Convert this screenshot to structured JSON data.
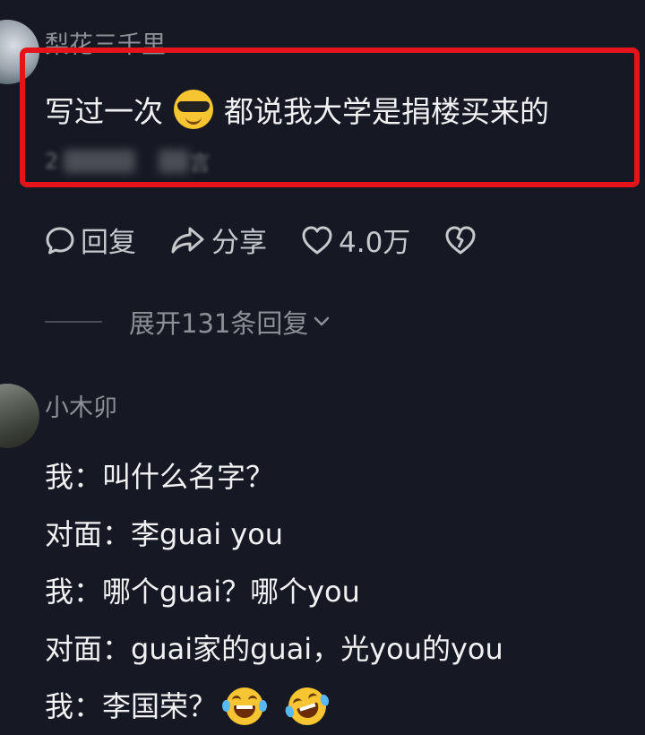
{
  "comment1": {
    "username": "梨花三千里",
    "text_before_emoji": "写过一次",
    "emoji": "cool-sunglasses-emoji",
    "text_after_emoji": "都说我大学是捐楼买来的",
    "meta_partial": "2",
    "meta_partial_2": "言"
  },
  "actions": {
    "reply_label": "回复",
    "share_label": "分享",
    "like_count": "4.0万"
  },
  "expand_replies_label": "展开131条回复",
  "comment2": {
    "username": "小木卯",
    "lines": [
      "我：叫什么名字？",
      "对面：李guai you",
      "我：哪个guai？哪个you",
      "对面：guai家的guai，光you的you",
      "我：李国荣？"
    ],
    "trailing_emojis": [
      "rolling-laughing-emoji",
      "rolling-laughing-emoji"
    ]
  },
  "colors": {
    "background": "#161823",
    "highlight_border": "#e5141b",
    "primary_text": "#f1f1f3",
    "secondary_text": "#8e8f96"
  }
}
